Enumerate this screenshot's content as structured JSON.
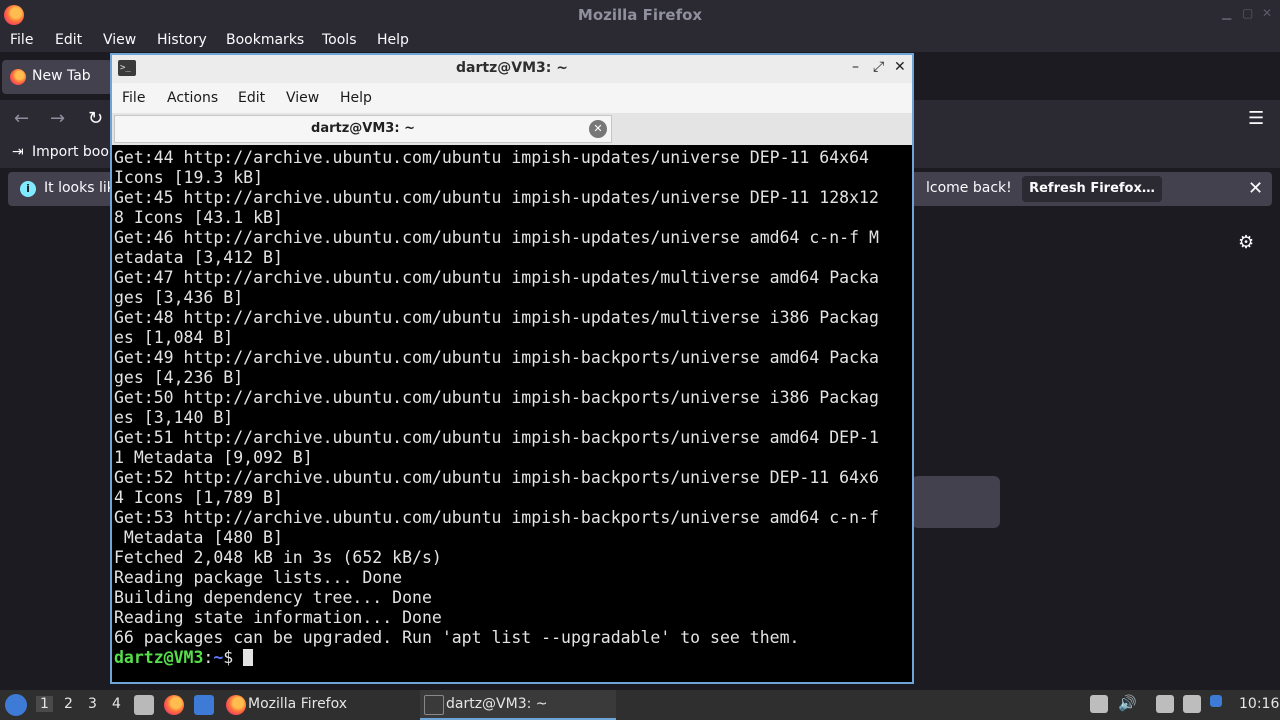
{
  "firefox": {
    "window_title": "Mozilla Firefox",
    "menu": [
      "File",
      "Edit",
      "View",
      "History",
      "Bookmarks",
      "Tools",
      "Help"
    ],
    "tab_label": "New Tab",
    "bookmark_label": "Import book",
    "notice_left": "It looks lik",
    "notice_right": "lcome back!",
    "refresh_label": "Refresh Firefox…"
  },
  "terminal": {
    "title": "dartz@VM3: ~",
    "menu": [
      "File",
      "Actions",
      "Edit",
      "View",
      "Help"
    ],
    "tab_label": "dartz@VM3: ~",
    "lines": [
      "Get:44 http://archive.ubuntu.com/ubuntu impish-updates/universe DEP-11 64x64",
      "Icons [19.3 kB]",
      "Get:45 http://archive.ubuntu.com/ubuntu impish-updates/universe DEP-11 128x12",
      "8 Icons [43.1 kB]",
      "Get:46 http://archive.ubuntu.com/ubuntu impish-updates/universe amd64 c-n-f M",
      "etadata [3,412 B]",
      "Get:47 http://archive.ubuntu.com/ubuntu impish-updates/multiverse amd64 Packa",
      "ges [3,436 B]",
      "Get:48 http://archive.ubuntu.com/ubuntu impish-updates/multiverse i386 Packag",
      "es [1,084 B]",
      "Get:49 http://archive.ubuntu.com/ubuntu impish-backports/universe amd64 Packa",
      "ges [4,236 B]",
      "Get:50 http://archive.ubuntu.com/ubuntu impish-backports/universe i386 Packag",
      "es [3,140 B]",
      "Get:51 http://archive.ubuntu.com/ubuntu impish-backports/universe amd64 DEP-1",
      "1 Metadata [9,092 B]",
      "Get:52 http://archive.ubuntu.com/ubuntu impish-backports/universe DEP-11 64x6",
      "4 Icons [1,789 B]",
      "Get:53 http://archive.ubuntu.com/ubuntu impish-backports/universe amd64 c-n-f",
      " Metadata [480 B]",
      "Fetched 2,048 kB in 3s (652 kB/s)",
      "Reading package lists... Done",
      "Building dependency tree... Done",
      "Reading state information... Done",
      "66 packages can be upgraded. Run 'apt list --upgradable' to see them."
    ],
    "prompt_user": "dartz@VM3",
    "prompt_path": "~",
    "prompt_sep": ":",
    "prompt_symbol": "$"
  },
  "taskbar": {
    "workspaces": [
      "1",
      "2",
      "3",
      "4"
    ],
    "tasks": [
      {
        "label": "Mozilla Firefox"
      },
      {
        "label": "dartz@VM3: ~"
      }
    ],
    "clock": "10:16"
  },
  "icons": {
    "firefox_logo": "firefox-logo-icon",
    "terminal_app": "terminal-icon",
    "settings": "gear-icon",
    "info": "info-icon"
  },
  "colors": {
    "prompt_user": "#55e04a",
    "prompt_path": "#5a7bff",
    "window_accent": "#6ea5d8"
  }
}
